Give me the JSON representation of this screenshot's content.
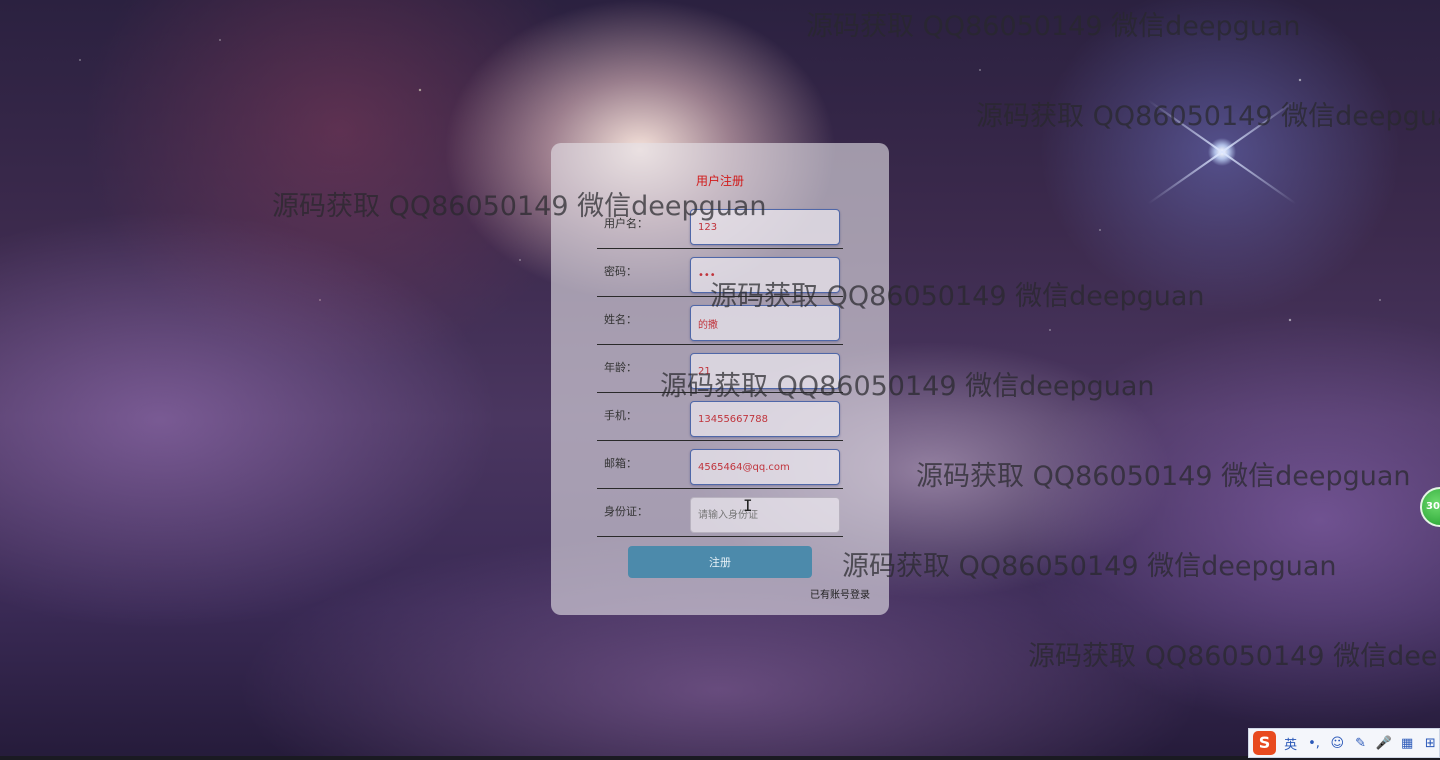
{
  "watermark_text": "源码获取 QQ86050149 微信deepguan",
  "form": {
    "title": "用户注册",
    "fields": [
      {
        "label": "用户名：",
        "value": "123",
        "placeholder": ""
      },
      {
        "label": "密码：",
        "value": "•••",
        "placeholder": ""
      },
      {
        "label": "姓名：",
        "value": "的撒",
        "placeholder": ""
      },
      {
        "label": "年龄：",
        "value": "21",
        "placeholder": ""
      },
      {
        "label": "手机：",
        "value": "13455667788",
        "placeholder": ""
      },
      {
        "label": "邮箱：",
        "value": "4565464@qq.com",
        "placeholder": ""
      },
      {
        "label": "身份证：",
        "value": "",
        "placeholder": "请输入身份证"
      }
    ],
    "submit_label": "注册",
    "login_link": "已有账号登录"
  },
  "side_badge": "30",
  "ime": {
    "logo": "S",
    "items": [
      "英",
      "•,",
      "☺",
      "✎",
      "🎤",
      "▦",
      "⊞"
    ]
  },
  "colors": {
    "title": "#d11a1a",
    "input_text": "#c0343c",
    "button": "#4c8aab"
  }
}
